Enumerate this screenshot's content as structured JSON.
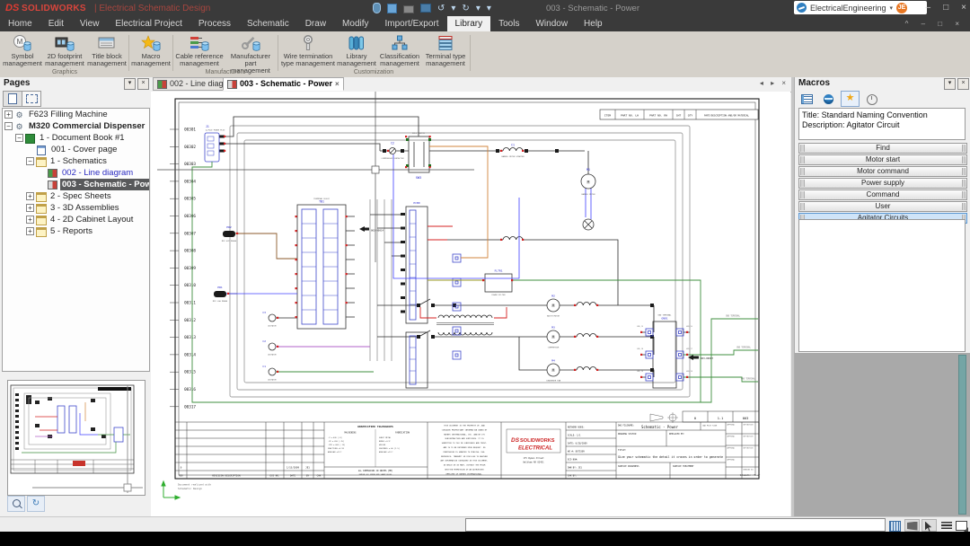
{
  "titlebar": {
    "brand_mark": "DS",
    "brand": "SOLIDWORKS",
    "app_name": "|  Electrical Schematic Design",
    "doc_title": "003 - Schematic - Power",
    "account_name": "ElectricalEngineering",
    "account_caret": "▾",
    "avatar_initials": "JE",
    "undo_glyph": "↺",
    "redo_glyph": "↻",
    "caret_glyph": "▾",
    "win_min": "–",
    "win_max": "□",
    "win_close": "×"
  },
  "menu": {
    "items": [
      "Home",
      "Edit",
      "View",
      "Electrical Project",
      "Process",
      "Schematic",
      "Draw",
      "Modify",
      "Import/Export",
      "Library",
      "Tools",
      "Window",
      "Help"
    ],
    "active": "Library",
    "corner_glyphs": "^ – □ ×"
  },
  "ribbon": {
    "buttons": [
      {
        "label1": "Symbol",
        "label2": "management"
      },
      {
        "label1": "2D footprint",
        "label2": "management"
      },
      {
        "label1": "Title block",
        "label2": "management"
      },
      {
        "label1": "Macro",
        "label2": "management"
      },
      {
        "label1": "Cable reference",
        "label2": "management"
      },
      {
        "label1": "Manufacturer",
        "label2": "part management"
      },
      {
        "label1": "Wire termination",
        "label2": "type management"
      },
      {
        "label1": "Library",
        "label2": "management"
      },
      {
        "label1": "Classification",
        "label2": "management"
      },
      {
        "label1": "Terminal type",
        "label2": "management"
      }
    ],
    "groups": [
      {
        "label": "Graphics"
      },
      {
        "label": "Manufacturers"
      },
      {
        "label": "Customization"
      }
    ]
  },
  "pages_panel": {
    "title": "Pages",
    "pin_glyph": "▾",
    "close_glyph": "×",
    "tree": [
      {
        "label": "F623 Filling Machine"
      },
      {
        "label": "M320 Commercial Dispenser"
      },
      {
        "label": "1 - Document Book #1"
      },
      {
        "label": "001 - Cover page"
      },
      {
        "label": "1 - Schematics"
      },
      {
        "label": "002 - Line diagram"
      },
      {
        "label": "003 - Schematic - Power"
      },
      {
        "label": "2 - Spec Sheets"
      },
      {
        "label": "3 - 3D Assemblies"
      },
      {
        "label": "4 - 2D Cabinet Layout"
      },
      {
        "label": "5 - Reports"
      }
    ],
    "refresh_glyph": "↻"
  },
  "doc_tabs": {
    "tab1": "002 - Line diagram",
    "tab2": "003 - Schematic - Power",
    "close_glyph": "×",
    "nav_glyphs": "◂ ▸ ×"
  },
  "macros_panel": {
    "title": "Macros",
    "pin_glyph": "▾",
    "close_glyph": "×",
    "star_glyph": "★",
    "info_line1": "Title: Standard Naming Convention",
    "info_line2": "Description: Agitator Circuit",
    "groups": [
      "Find",
      "Motor start",
      "Motor command",
      "Power supply",
      "Command",
      "User",
      "Agitator Circuits"
    ]
  },
  "statusbar": {
    "command_value": ""
  },
  "schematic": {
    "wire_numbers": [
      "00301",
      "00302",
      "00303",
      "00304",
      "00305",
      "00306",
      "00307",
      "00308",
      "00309",
      "00310",
      "00311",
      "00312",
      "00313",
      "00314",
      "00315",
      "00316",
      "00317"
    ],
    "header_cells": [
      "ITEM",
      "PART NO. LH",
      "PART NO. RH",
      "SHT",
      "QTY",
      "PART/DESCRIPTION AND/OR MATERIAL"
    ],
    "components": {
      "motor_letter": "M",
      "j1": {
        "ref": "J1",
        "desc": "4-POLE POWER PLUG"
      },
      "tb1": {
        "ref": "TB1",
        "desc": "TERMINAL BLOCK"
      },
      "sw3": {
        "ref": "SW3",
        "desc": "KILL SWITCH"
      },
      "c2": {
        "ref": "C2",
        "desc": "COMPRESSOR CONTACTOR"
      },
      "c1": {
        "ref": "C1",
        "desc": "BARREL MOTOR STARTER"
      },
      "m1": {
        "ref": "M1",
        "desc": "BARREL MOTOR"
      },
      "pcb": {
        "ref": "PCB0"
      },
      "pr2": {
        "ref": "PR2",
        "desc": "MIX OUT PROBE"
      },
      "pr1": {
        "ref": "PR1",
        "desc": "MIX LOW PROBE"
      },
      "fltr1": {
        "ref": "FLTR1",
        "desc": "POWER FILTER"
      },
      "m2": {
        "ref": "M2",
        "desc": "BATCH MOTOR"
      },
      "m3": {
        "ref": "M3",
        "desc": "COMPRESSOR"
      },
      "m4": {
        "ref": "M4",
        "desc": "CONDENSER FAN"
      },
      "gnd1": {
        "ref": "GND1",
        "desc": "GND TERMINAL"
      },
      "agitators": [
        {
          "ref": "C3"
        },
        {
          "ref": "C2"
        },
        {
          "ref": "C1"
        }
      ],
      "agitator_desc": "AGITATOR",
      "gnd_pins": [
        "GND_13",
        "GND_14",
        "GND_15",
        "GND_16",
        "GND_17",
        "GND_18"
      ],
      "gnd_exit_label": "GND TERMINAL",
      "xref1": "003-00014",
      "xref2": "003-00007"
    },
    "titleblock": {
      "unspecified": "UNSPECIFIED TOLERANCES",
      "machining": "MACHINING",
      "fabrication": "FABRICATION",
      "tol_rows": [
        ".X ±.030 [.8]",
        ".XX ±.010 [.25]",
        ".XXX ±.005 [.13]",
        "FRACTIONS ±1/32",
        "ANGULAR ±1/2°"
      ],
      "fab_rows": [
        "SHEET METAL",
        "BENDS ±1/2°",
        "WELDED",
        "FEATURES ±.06 [1.5]",
        "ANGULAR ±1/2°"
      ],
      "dims_note1": "ALL DIMENSIONS IN INCHES [MM]",
      "dims_note2": "REMOVE ALL BURRS AND SHARP EDGES",
      "rev_headers": [
        "REV",
        "REVISION DESCRIPTION",
        "ECO NO.",
        "DATE",
        "BY",
        "CHK"
      ],
      "rev_val": "0",
      "rev_date": "1/15/2009",
      "rev_by": "JE1",
      "prop_lines": [
        "THIS DOCUMENT IS THE PROPERTY OF, AND",
        "CONTAINS PROPRIETARY INFORMATION OWNED BY",
        "HAYNES INTERNATIONAL, INC. AND/OR ITS",
        "SUBCONTRACTORS AND SUPPLIERS. IT IS",
        "SUBMITTED TO YOU IN CONFIDENCE AND TRUST,",
        "AND IS TO BE RETURNED UPON REQUEST. NO",
        "PERMISSION IS GRANTED TO PUBLISH, USE,",
        "REPRODUCE, TRANSMIT OR DISCLOSE TO ANOTHER",
        "ANY INFORMATION CONTAINED IN THIS DOCUMENT,",
        "IN WHOLE OR IN PART, WITHOUT THE PRIOR",
        "WRITTEN PERMISSION OF AN AUTHORIZED",
        "EMPLOYEE OF HAYNES INTERNATIONAL."
      ],
      "brand_mark": "DS",
      "brand": "SOLIDWORKS",
      "brand2": "ELECTRICAL",
      "address1": "175 Wyman Street",
      "address2": "Waltham MA 02451",
      "f_network": "NETWORK NODE:",
      "f_scale": "SCALE:  1/1",
      "f_date": "DATE: 6/28/2009",
      "f_wo": "WO #: 8675309",
      "f_eco": "ECO NO#:",
      "f_dwn": "DWN BY: JE1",
      "f_chk": "CHK BY:",
      "fn_label": "DWG FILENAME:",
      "fn_value": "Schematic - Power",
      "plot": "CAD PLOT SIZE",
      "status": "DRAWING STATUS:",
      "replaced": "REPLACED BY:",
      "title_label": "TITLE:",
      "title_value": "Give your schematic the detail it craves in order to generate",
      "surf1": "SURFACE ROUGHNESS",
      "surf2": "SURFACE TREATMENT",
      "cell_approval": "APPROVAL",
      "cell_definition": "DEFINITION",
      "cell_drawing": "DRAWING NO:",
      "sheet_rev": "0",
      "sheet_scale": "1.1",
      "sheet_no": "003",
      "sheet_name": "Schematic - Power",
      "footer1": "Document realized with",
      "footer2": "Schematic Design"
    }
  }
}
